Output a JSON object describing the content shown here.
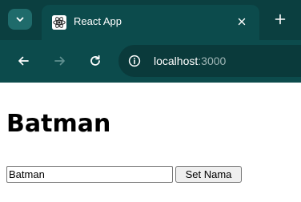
{
  "browser": {
    "tab": {
      "title": "React App",
      "close_glyph": "×",
      "favicon": "react-logo-icon"
    },
    "new_tab_glyph": "+",
    "address": {
      "host": "localhost",
      "port": ":3000"
    },
    "colors": {
      "frame": "#0b3f40",
      "toolbar": "#0c4b4c",
      "omnibox": "#0a3a3b"
    }
  },
  "page": {
    "heading": "Batman",
    "name_input_value": "Batman",
    "set_button_label": "Set Nama"
  }
}
